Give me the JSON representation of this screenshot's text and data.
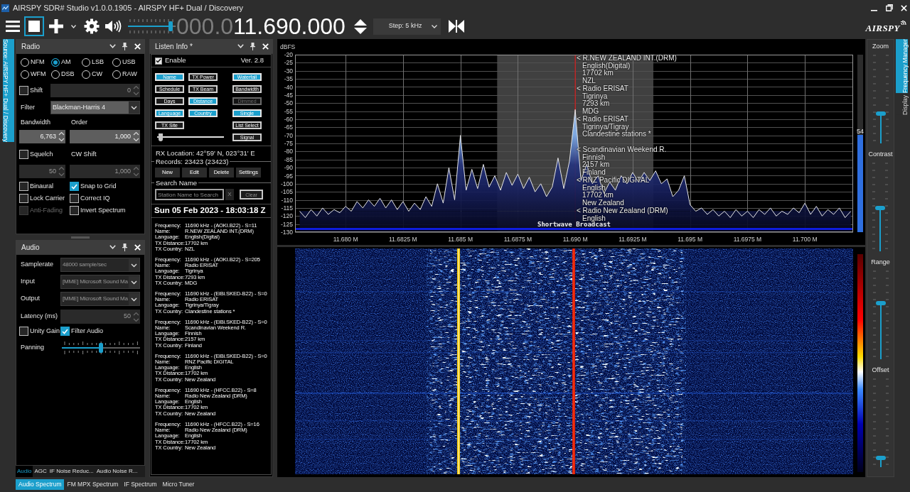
{
  "window": {
    "title": "AIRSPY SDR# Studio v1.0.0.1905 - AIRSPY HF+ Dual / Discovery"
  },
  "toolbar": {
    "volume": {
      "level": 0.9
    },
    "frequency": {
      "prefix": "000.0",
      "value": "11.690.000"
    },
    "step": "Step: 5 kHz",
    "logo": "AIRSPY"
  },
  "left_tabs": [
    {
      "label": "Source: AIRSPY HF+ Dual / Discovery",
      "selected": true
    }
  ],
  "radio": {
    "title": "Radio",
    "modes": [
      {
        "label": "NFM",
        "selected": false
      },
      {
        "label": "AM",
        "selected": true
      },
      {
        "label": "LSB",
        "selected": false
      },
      {
        "label": "USB",
        "selected": false
      },
      {
        "label": "WFM",
        "selected": false
      },
      {
        "label": "DSB",
        "selected": false
      },
      {
        "label": "CW",
        "selected": false
      },
      {
        "label": "RAW",
        "selected": false
      }
    ],
    "shift": {
      "label": "Shift",
      "checked": false,
      "value": "0",
      "disabled": true
    },
    "filter": {
      "label": "Filter",
      "value": "Blackman-Harris 4"
    },
    "bandwidth": {
      "label": "Bandwidth",
      "value": "6,763",
      "disabled": false
    },
    "order": {
      "label": "Order",
      "value": "1,000",
      "disabled": false
    },
    "squelch": {
      "label": "Squelch",
      "checked": false,
      "value": "50",
      "disabled": true
    },
    "cw_shift": {
      "label": "CW Shift",
      "value": "1,000",
      "disabled": true
    },
    "options": [
      {
        "label": "Binaural",
        "checked": false,
        "disabled": false
      },
      {
        "label": "Snap to Grid",
        "checked": true,
        "disabled": false
      },
      {
        "label": "Lock Carrier",
        "checked": false,
        "disabled": false
      },
      {
        "label": "Correct IQ",
        "checked": false,
        "disabled": false
      },
      {
        "label": "Anti-Fading",
        "checked": false,
        "disabled": true
      },
      {
        "label": "Invert Spectrum",
        "checked": false,
        "disabled": false
      }
    ]
  },
  "audio": {
    "title": "Audio",
    "fields": [
      {
        "kind": "dropdown",
        "label": "Samplerate",
        "value": "48000 sample/sec",
        "disabled": true
      },
      {
        "kind": "dropdown",
        "label": "Input",
        "value": "[MME] Microsoft Sound Ma",
        "disabled": true
      },
      {
        "kind": "dropdown",
        "label": "Output",
        "value": "[MME] Microsoft Sound Ma",
        "disabled": true
      },
      {
        "kind": "spinner",
        "label": "Latency (ms)",
        "value": "50",
        "disabled": true
      }
    ],
    "options": [
      {
        "label": "Unity Gain",
        "checked": false
      },
      {
        "label": "Filter Audio",
        "checked": true
      }
    ],
    "panning": {
      "label": "Panning",
      "level": 0.5
    },
    "tabs": [
      {
        "label": "Audio",
        "selected": true
      },
      {
        "label": "AGC",
        "selected": false
      },
      {
        "label": "IF Noise Reduc...",
        "selected": false
      },
      {
        "label": "Audio Noise R...",
        "selected": false
      }
    ]
  },
  "listen_info": {
    "title": "Listen Info *",
    "enable": {
      "label": "Enable",
      "checked": true
    },
    "version": "Ver. 2.8",
    "toggle_columns": [
      [
        {
          "label": "Name",
          "on": true,
          "disabled": false
        },
        {
          "label": "Schedule",
          "on": false,
          "disabled": false
        },
        {
          "label": "Days",
          "on": false,
          "disabled": false
        },
        {
          "label": "Language",
          "on": true,
          "disabled": false
        },
        {
          "label": "TX Site",
          "on": false,
          "disabled": false
        }
      ],
      [
        {
          "label": "TX Power",
          "on": false,
          "disabled": false
        },
        {
          "label": "TX Beam",
          "on": false,
          "disabled": false
        },
        {
          "label": "Distance",
          "on": true,
          "disabled": false
        },
        {
          "label": "Country",
          "on": true,
          "disabled": false
        }
      ],
      [
        {
          "label": "Waterfall",
          "on": true,
          "disabled": false
        },
        {
          "label": "Bandwidth",
          "on": false,
          "disabled": false
        },
        {
          "label": "Dimmed",
          "on": false,
          "disabled": true
        },
        {
          "label": "Single",
          "on": true,
          "disabled": false
        },
        {
          "label": "List Select",
          "on": false,
          "disabled": false
        },
        {
          "label": "Signal",
          "on": false,
          "disabled": false
        }
      ]
    ],
    "slider": {
      "level": 0.02
    },
    "rx_location": "RX Location: 42°59' N, 023°31' E",
    "records": "Records: 23423 (23423)",
    "record_buttons": [
      "New",
      "Edit",
      "Delete",
      "Settings"
    ],
    "search": {
      "legend": "Search Name",
      "placeholder": "Station Name to Search",
      "clear_x": "X",
      "clear_button": "Clear"
    },
    "timestamp": "Sun 05 Feb 2023 - 18:03:18 Z",
    "entries": [
      {
        "fields": [
          {
            "label": "Frequency:",
            "value": "11690 kHz - (AOKI.B22) - S=11"
          },
          {
            "label": "Name:",
            "value": "R.NEW ZEALAND INT.(DRM)"
          },
          {
            "label": "Language:",
            "value": "English(Digital)"
          },
          {
            "label": "TX Distance:",
            "value": "17702 km"
          },
          {
            "label": "TX Country:",
            "value": "NZL"
          }
        ]
      },
      {
        "fields": [
          {
            "label": "Frequency:",
            "value": "11690 kHz - (AOKI.B22) - S=205"
          },
          {
            "label": "Name:",
            "value": "Radio ERISAT"
          },
          {
            "label": "Language:",
            "value": "Tigrinya"
          },
          {
            "label": "TX Distance:",
            "value": "7293 km"
          },
          {
            "label": "TX Country:",
            "value": "MDG"
          }
        ]
      },
      {
        "fields": [
          {
            "label": "Frequency:",
            "value": "11690 kHz - (EiBi.SKED-B22) - S=0"
          },
          {
            "label": "Name:",
            "value": "Radio ERISAT"
          },
          {
            "label": "Language:",
            "value": "Tigrinya/Tigray"
          },
          {
            "label": "TX Country:",
            "value": "Clandestine stations *"
          }
        ]
      },
      {
        "fields": [
          {
            "label": "Frequency:",
            "value": "11690 kHz - (EiBi.SKED-B22) - S=0"
          },
          {
            "label": "Name:",
            "value": "Scandinavian Weekend R."
          },
          {
            "label": "Language:",
            "value": "Finnish"
          },
          {
            "label": "TX Distance:",
            "value": "2157 km"
          },
          {
            "label": "TX Country:",
            "value": "Finland"
          }
        ]
      },
      {
        "fields": [
          {
            "label": "Frequency:",
            "value": "11690 kHz - (EiBi.SKED-B22) - S=0"
          },
          {
            "label": "Name:",
            "value": "RNZ Pacific DIGITAL"
          },
          {
            "label": "Language:",
            "value": "English"
          },
          {
            "label": "TX Distance:",
            "value": "17702 km"
          },
          {
            "label": "TX Country:",
            "value": "New Zealand"
          }
        ]
      },
      {
        "fields": [
          {
            "label": "Frequency:",
            "value": "11690 kHz - (HFCC.B22) - S=8"
          },
          {
            "label": "Name:",
            "value": "Radio New Zealand (DRM)"
          },
          {
            "label": "Language:",
            "value": "English"
          },
          {
            "label": "TX Distance:",
            "value": "17702 km"
          },
          {
            "label": "TX Country:",
            "value": "New Zealand"
          }
        ]
      },
      {
        "fields": [
          {
            "label": "Frequency:",
            "value": "11690 kHz - (HFCC.B22) - S=16"
          },
          {
            "label": "Name:",
            "value": "Radio New Zealand (DRM)"
          },
          {
            "label": "Language:",
            "value": "English"
          },
          {
            "label": "TX Distance:",
            "value": "17702 km"
          },
          {
            "label": "TX Country:",
            "value": "New Zealand"
          }
        ]
      }
    ]
  },
  "spectrum": {
    "chart_data": [
      {
        "type": "area",
        "ylabel": "dBFS",
        "color": "#e6e6e6",
        "grid": true,
        "xlim": [
          11.6778,
          11.7021
        ],
        "ylim": [
          -130,
          -20
        ],
        "xticks": [
          {
            "value": 11.68,
            "label": "11.680 M"
          },
          {
            "value": 11.6825,
            "label": "11.6825 M"
          },
          {
            "value": 11.685,
            "label": "11.685 M"
          },
          {
            "value": 11.6875,
            "label": "11.6875 M"
          },
          {
            "value": 11.69,
            "label": "11.690 M"
          },
          {
            "value": 11.6925,
            "label": "11.6925 M"
          },
          {
            "value": 11.695,
            "label": "11.695 M"
          },
          {
            "value": 11.6975,
            "label": "11.6975 M"
          },
          {
            "value": 11.7,
            "label": "11.700 M"
          }
        ],
        "yticks": [
          -130,
          -125,
          -120,
          -115,
          -110,
          -105,
          -100,
          -95,
          -90,
          -85,
          -80,
          -75,
          -70,
          -65,
          -60,
          -55,
          -50,
          -45,
          -40,
          -35,
          -30,
          -25,
          -20
        ],
        "bands": [
          {
            "axis": "x",
            "from": 11.6866,
            "to": 11.6934,
            "color": "#404040"
          }
        ],
        "ref_lines": [
          {
            "axis": "x",
            "value": 11.69,
            "color": "#d01010"
          },
          {
            "axis": "y",
            "value": -128,
            "label": "Shortwave Broadcast",
            "color": "#1020ff"
          }
        ],
        "x": [
          11.678,
          11.67825,
          11.6785,
          11.67875,
          11.679,
          11.67925,
          11.6795,
          11.67975,
          11.68,
          11.68025,
          11.6805,
          11.68075,
          11.681,
          11.68125,
          11.6815,
          11.68175,
          11.682,
          11.68225,
          11.6825,
          11.68275,
          11.683,
          11.68325,
          11.6835,
          11.68375,
          11.684,
          11.68425,
          11.6845,
          11.68475,
          11.685,
          11.68525,
          11.6855,
          11.68575,
          11.686,
          11.68625,
          11.6865,
          11.68675,
          11.687,
          11.68725,
          11.6875,
          11.68775,
          11.688,
          11.68825,
          11.6885,
          11.68875,
          11.689,
          11.68925,
          11.6895,
          11.68975,
          11.69,
          11.69025,
          11.6905,
          11.69075,
          11.691,
          11.69125,
          11.6915,
          11.69175,
          11.692,
          11.69225,
          11.6925,
          11.69275,
          11.693,
          11.69325,
          11.6935,
          11.69375,
          11.694,
          11.69425,
          11.6945,
          11.69475,
          11.695,
          11.69525,
          11.6955,
          11.69575,
          11.696,
          11.69625,
          11.6965,
          11.69675,
          11.697,
          11.69725,
          11.6975,
          11.69775,
          11.698,
          11.69825,
          11.6985,
          11.69875,
          11.699,
          11.69925,
          11.6995,
          11.69975,
          11.7,
          11.70025,
          11.7005,
          11.70075,
          11.701,
          11.70125,
          11.7015,
          11.70175,
          11.702
        ],
        "values": [
          -117,
          -121,
          -116,
          -120,
          -115,
          -119,
          -116,
          -118,
          -114,
          -117,
          -111,
          -115,
          -110,
          -114,
          -109,
          -115,
          -110,
          -116,
          -111,
          -117,
          -112,
          -116,
          -108,
          -114,
          -100,
          -112,
          -90,
          -110,
          -70,
          -104,
          -91,
          -103,
          -88,
          -102,
          -95,
          -104,
          -93,
          -101,
          -94,
          -103,
          -96,
          -105,
          -100,
          -108,
          -102,
          -84,
          -103,
          -86,
          -54,
          -98,
          -88,
          -100,
          -95,
          -106,
          -99,
          -104,
          -95,
          -100,
          -93,
          -99,
          -93,
          -98,
          -92,
          -100,
          -97,
          -108,
          -104,
          -95,
          -113,
          -117,
          -115,
          -119,
          -116,
          -120,
          -117,
          -121,
          -116,
          -120,
          -117,
          -121,
          -116,
          -119,
          -115,
          -120,
          -117,
          -119,
          -115,
          -118,
          -112,
          -119,
          -114,
          -120,
          -116,
          -119,
          -115,
          -121,
          -117
        ]
      }
    ],
    "station_labels": [
      {
        "lines": [
          "< R.NEW ZEALAND INT.(DRM)",
          "English(Digital)",
          "17702 km",
          "NZL"
        ]
      },
      {
        "lines": [
          "< Radio ERISAT",
          "Tigrinya",
          "7293 km",
          "MDG"
        ]
      },
      {
        "lines": [
          "< Radio ERISAT",
          "Tigrinya/Tigray",
          "Clandestine stations *"
        ]
      },
      {
        "lines": [
          "< Scandinavian Weekend R.",
          "Finnish",
          "2157 km",
          "Finland"
        ]
      },
      {
        "lines": [
          "< RNZ Pacific DIGITAL",
          "English",
          "17702 km",
          "New Zealand"
        ]
      },
      {
        "lines": [
          "< Radio New Zealand (DRM)",
          "English"
        ]
      }
    ],
    "signal_meter": {
      "reading": "54",
      "level": 0.55
    }
  },
  "display_sliders": [
    {
      "label": "Zoom",
      "level": 0.33
    },
    {
      "label": "Contrast",
      "level": 0.48
    },
    {
      "label": "Range",
      "level": 0.62
    },
    {
      "label": "Offset",
      "level": 0.1
    }
  ],
  "right_tabs": [
    {
      "label": "Frequency Manager",
      "selected": true
    },
    {
      "label": "Display",
      "selected": false
    }
  ],
  "bottom_tabs": [
    {
      "label": "Audio Spectrum",
      "selected": true
    },
    {
      "label": "FM MPX Spectrum",
      "selected": false
    },
    {
      "label": "IF Spectrum",
      "selected": false
    },
    {
      "label": "Micro Tuner",
      "selected": false
    }
  ]
}
